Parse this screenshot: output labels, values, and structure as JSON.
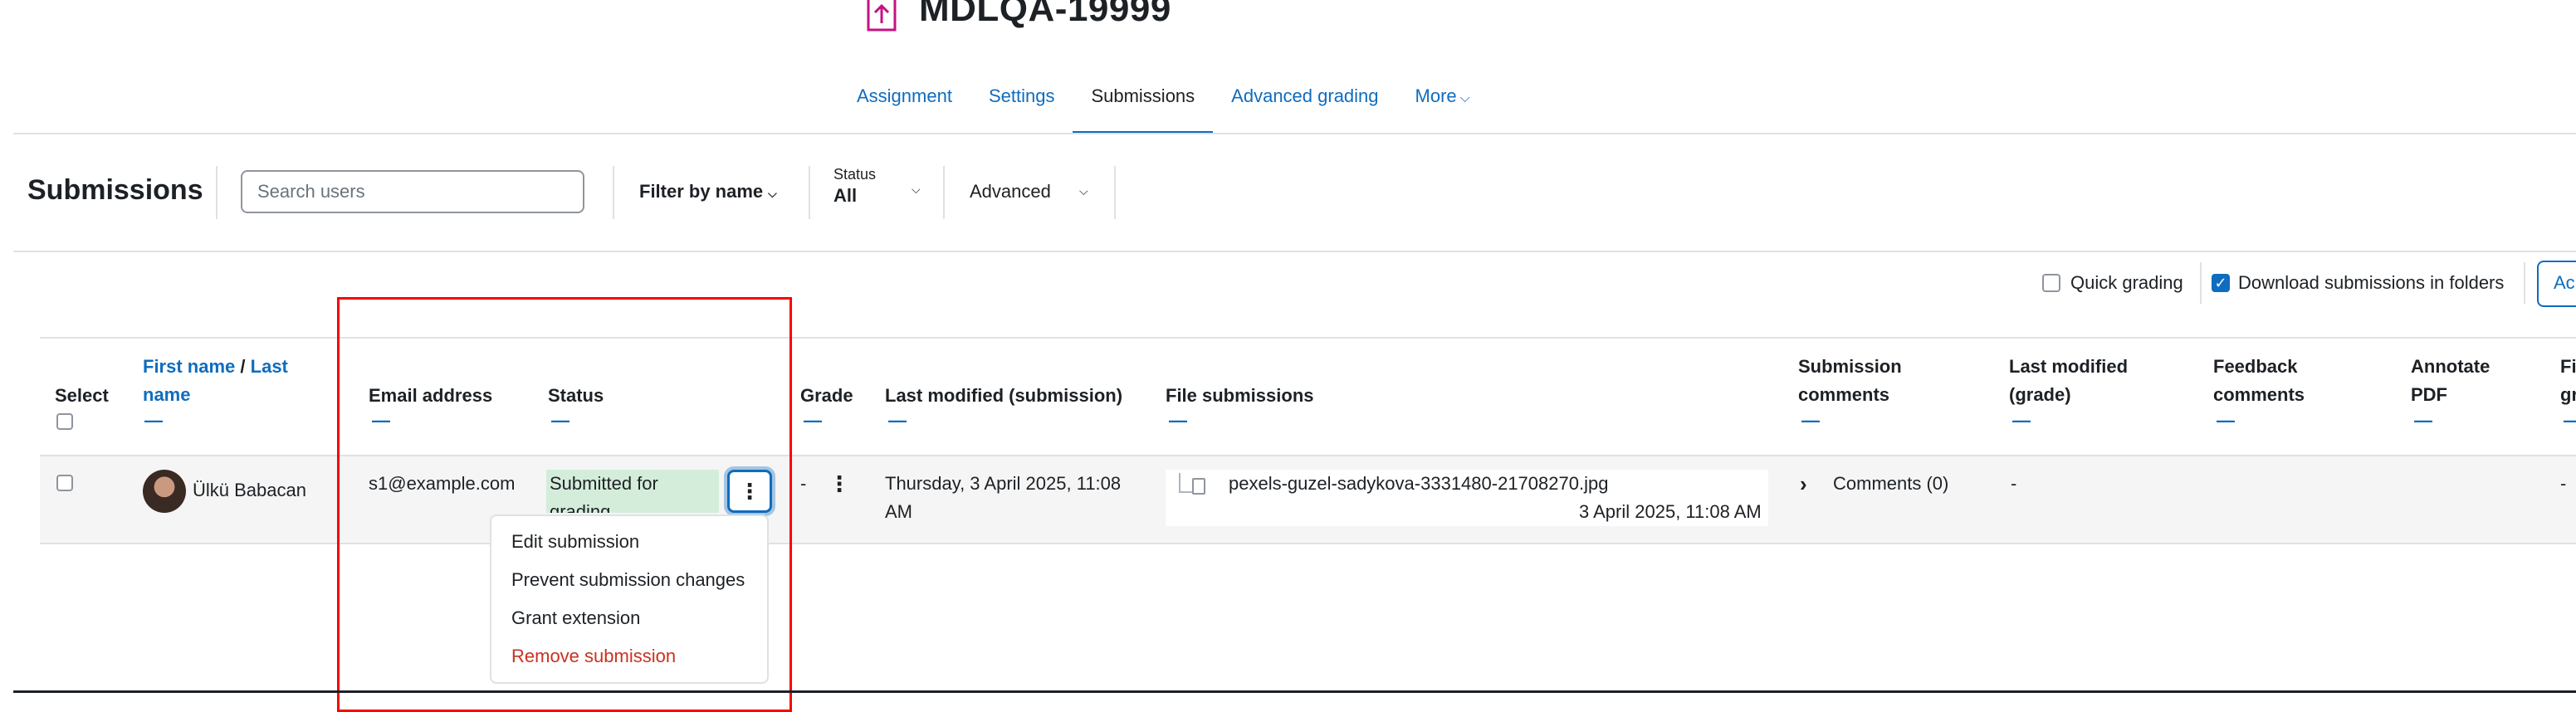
{
  "header": {
    "title": "MDLQA-19999",
    "icon": "assignment-upload-icon",
    "accent_color": "#c4127f"
  },
  "tabs": [
    {
      "label": "Assignment",
      "active": false
    },
    {
      "label": "Settings",
      "active": false
    },
    {
      "label": "Submissions",
      "active": true
    },
    {
      "label": "Advanced grading",
      "active": false
    },
    {
      "label": "More",
      "active": false
    }
  ],
  "toolbar": {
    "heading": "Submissions",
    "search_placeholder": "Search users",
    "filter_by_name": "Filter by name",
    "status_label": "Status",
    "status_value": "All",
    "advanced": "Advanced"
  },
  "options": {
    "quick_grading": {
      "label": "Quick grading",
      "checked": false
    },
    "download_in_folders": {
      "label": "Download submissions in folders",
      "checked": true
    },
    "action_button": "Ac"
  },
  "table": {
    "headers": {
      "select": "Select",
      "first_name": "First name",
      "slash": "/",
      "last_name": "Last name",
      "email": "Email address",
      "status": "Status",
      "grade": "Grade",
      "last_modified_submission": "Last modified (submission)",
      "file_submissions": "File submissions",
      "submission_comments": "Submission comments",
      "last_modified_grade": "Last modified (grade)",
      "feedback_comments": "Feedback comments",
      "annotate_pdf": "Annotate PDF",
      "final_grade": "Fi gr"
    },
    "collapse_symbol": "—",
    "row": {
      "name": "Ülkü Babacan",
      "email": "s1@example.com",
      "status": "Submitted for grading",
      "grade": "-",
      "last_modified": "Thursday, 3 April 2025, 11:08 AM",
      "file_name": "pexels-guzel-sadykova-3331480-21708270.jpg",
      "file_date": "3 April 2025, 11:08 AM",
      "comments": "Comments (0)",
      "last_modified_grade": "-",
      "final_grade": "-"
    }
  },
  "menu": {
    "items": [
      {
        "label": "Edit submission",
        "danger": false
      },
      {
        "label": "Prevent submission changes",
        "danger": false
      },
      {
        "label": "Grant extension",
        "danger": false
      },
      {
        "label": "Remove submission",
        "danger": true
      }
    ]
  },
  "colors": {
    "link": "#0f6cbf",
    "status_bg": "#d4edda",
    "danger": "#ca3120",
    "highlight": "#ff0000"
  }
}
